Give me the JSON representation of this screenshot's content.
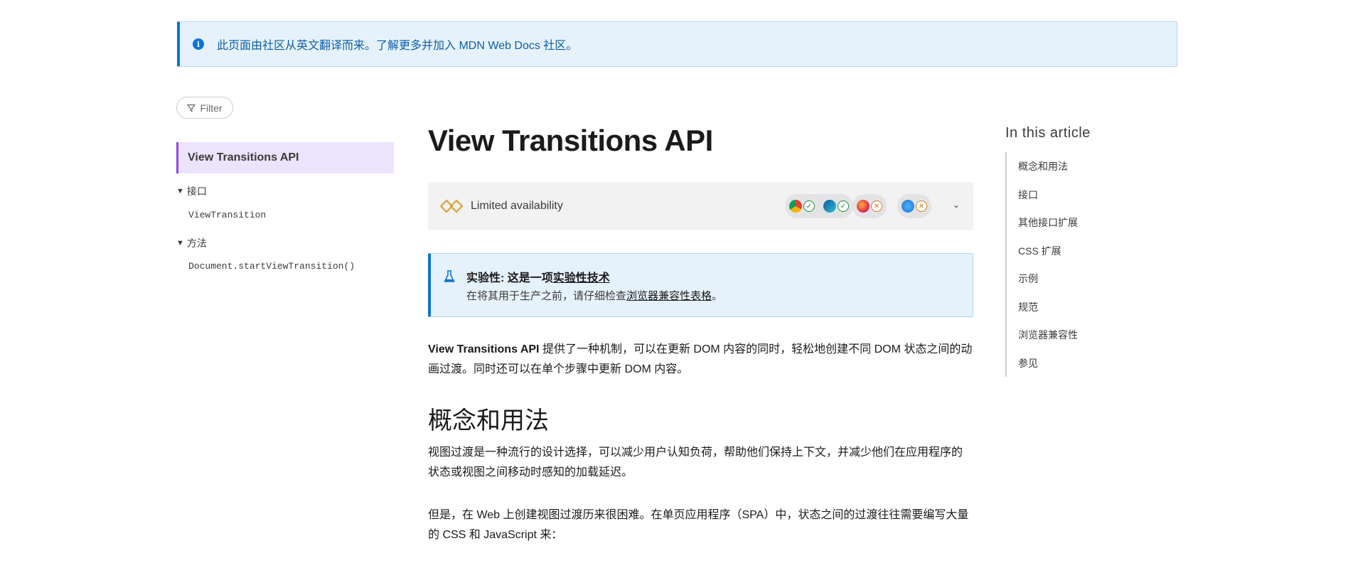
{
  "notice": {
    "text": "此页面由社区从英文翻译而来。了解更多并加入 MDN Web Docs 社区。"
  },
  "sidebar": {
    "filter_label": "Filter",
    "active_item": "View Transitions API",
    "groups": [
      {
        "title": "接口",
        "items": [
          "ViewTransition"
        ]
      },
      {
        "title": "方法",
        "items": [
          "Document.startViewTransition()"
        ]
      }
    ]
  },
  "main": {
    "title": "View Transitions API",
    "availability": {
      "label": "Limited availability",
      "browsers": [
        {
          "name": "chrome",
          "status": "supported"
        },
        {
          "name": "edge",
          "status": "supported"
        },
        {
          "name": "firefox",
          "status": "unsupported"
        },
        {
          "name": "safari",
          "status": "unsupported"
        }
      ]
    },
    "experimental": {
      "prefix": "实验性: 这是一项",
      "link": "实验性技术",
      "line2_prefix": "在将其用于生产之前，请仔细检查",
      "line2_link": "浏览器兼容性表格",
      "line2_suffix": "。"
    },
    "intro_bold": "View Transitions API",
    "intro_rest": " 提供了一种机制，可以在更新 DOM 内容的同时，轻松地创建不同 DOM 状态之间的动画过渡。同时还可以在单个步骤中更新 DOM 内容。",
    "section_heading": "概念和用法",
    "para1": "视图过渡是一种流行的设计选择，可以减少用户认知负荷，帮助他们保持上下文，并减少他们在应用程序的状态或视图之间移动时感知的加载延迟。",
    "para2": "但是，在 Web 上创建视图过渡历来很困难。在单页应用程序（SPA）中，状态之间的过渡往往需要编写大量的 CSS 和 JavaScript 来："
  },
  "toc": {
    "title": "In this article",
    "items": [
      "概念和用法",
      "接口",
      "其他接口扩展",
      "CSS 扩展",
      "示例",
      "规范",
      "浏览器兼容性",
      "参见"
    ]
  },
  "colors": {
    "accent_blue": "#0c74d6",
    "sidebar_active_bg": "#ece3fd",
    "sidebar_active_border": "#8a47f0"
  }
}
